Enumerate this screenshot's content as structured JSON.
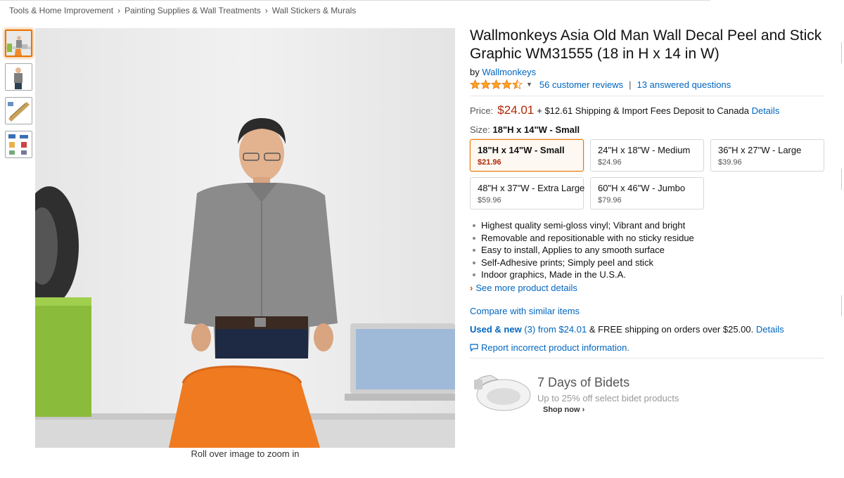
{
  "breadcrumb": [
    "Tools & Home Improvement",
    "Painting Supplies & Wall Treatments",
    "Wall Stickers & Murals"
  ],
  "breadcrumb_separator": "›",
  "product": {
    "title": "Wallmonkeys Asia Old Man Wall Decal Peel and Stick Graphic WM31555 (18 in H x 14 in W)",
    "by_prefix": "by",
    "brand": "Wallmonkeys",
    "rating_stars": 4.5,
    "reviews_label": "56 customer reviews",
    "questions_label": "13 answered questions",
    "zoom_hint": "Roll over image to zoom in"
  },
  "price": {
    "label": "Price:",
    "amount": "$24.01",
    "shipping_text": "+ $12.61 Shipping & Import Fees Deposit to Canada",
    "details_link": "Details",
    "color": "#b12704"
  },
  "size": {
    "label": "Size:",
    "selected": "18\"H x 14\"W - Small",
    "options": [
      {
        "name": "18\"H x 14\"W - Small",
        "price": "$21.96"
      },
      {
        "name": "24\"H x 18\"W - Medium",
        "price": "$24.96"
      },
      {
        "name": "36\"H x 27\"W - Large",
        "price": "$39.96"
      },
      {
        "name": "48\"H x 37\"W - Extra Large",
        "price": "$59.96"
      },
      {
        "name": "60\"H x 46\"W - Jumbo",
        "price": "$79.96"
      }
    ]
  },
  "bullets": [
    "Highest quality semi-gloss vinyl; Vibrant and bright",
    "Removable and repositionable with no sticky residue",
    "Easy to install, Applies to any smooth surface",
    "Self-Adhesive prints; Simply peel and stick",
    "Indoor graphics, Made in the U.S.A."
  ],
  "links": {
    "see_more": "See more product details",
    "compare": "Compare with similar items",
    "used_new": "Used & new",
    "used_count": "(3)",
    "used_from": "from $24.01",
    "free_shipping": "& FREE shipping on orders over $25.00.",
    "used_details": "Details",
    "report": "Report incorrect product information."
  },
  "ad": {
    "title": "7 Days of Bidets",
    "subtitle": "Up to 25% off select bidet products",
    "cta": "Shop now ›"
  },
  "colors": {
    "link": "#0066c0",
    "selected_border": "#e77600",
    "star": "#ffa41c"
  }
}
